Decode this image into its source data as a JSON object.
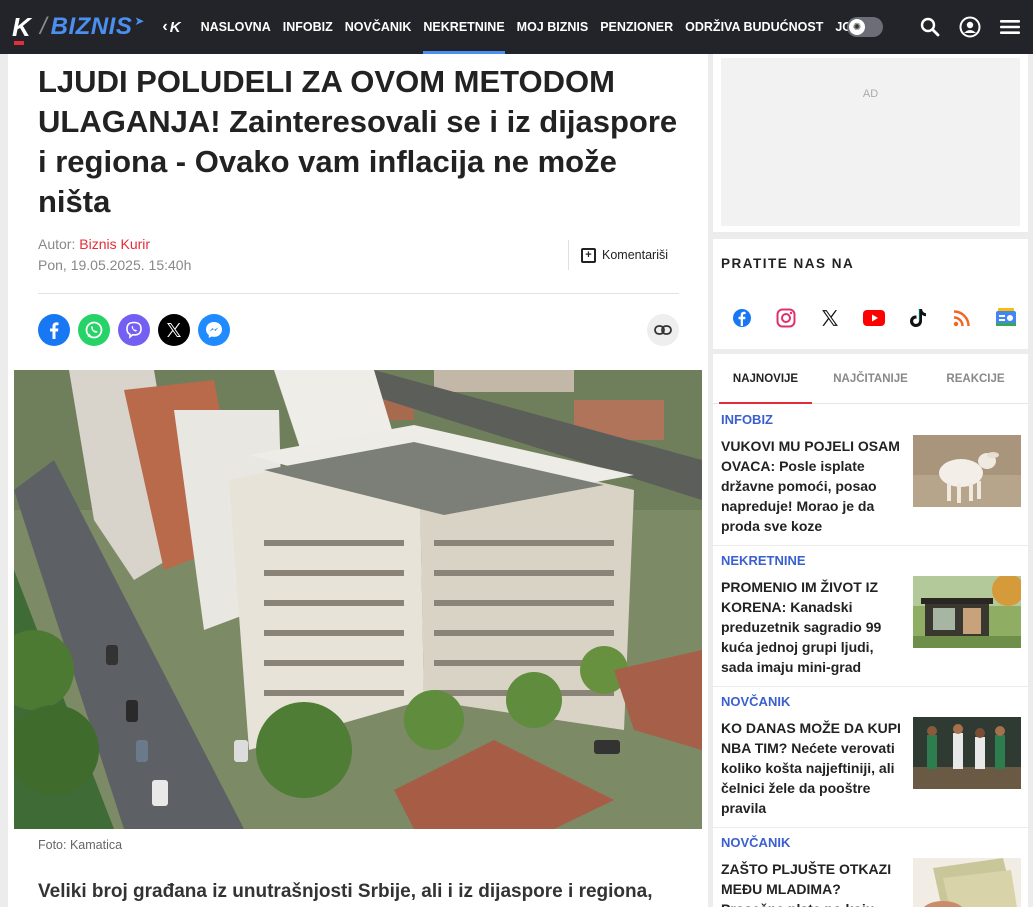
{
  "header": {
    "logo_k": "K",
    "logo_sep": "/",
    "logo_name": "BIZNIS",
    "back_label": "K",
    "nav": [
      {
        "label": "NASLOVNA",
        "active": false
      },
      {
        "label": "INFOBIZ",
        "active": false
      },
      {
        "label": "NOVČANIK",
        "active": false
      },
      {
        "label": "NEKRETNINE",
        "active": true
      },
      {
        "label": "MOJ BIZNIS",
        "active": false
      },
      {
        "label": "PENZIONER",
        "active": false
      },
      {
        "label": "ODRŽIVA BUDUĆNOST",
        "active": false
      },
      {
        "label": "JOŠ",
        "active": false
      }
    ],
    "icons": [
      "theme-toggle-icon",
      "search-icon",
      "user-icon",
      "menu-icon"
    ]
  },
  "article": {
    "headline": "LJUDI POLUDELI ZA OVOM METODOM ULAGANJA! Zainteresovali se i iz dijaspore i regiona - Ovako vam inflacija ne može ništa",
    "author_prefix": "Autor: ",
    "author_name": "Biznis Kurir",
    "date": "Pon, 19.05.2025. 15:40h",
    "comment_label": "Komentariši",
    "share": [
      {
        "name": "facebook-icon",
        "color": "#1877f2",
        "glyph": "f"
      },
      {
        "name": "whatsapp-icon",
        "color": "#25d366",
        "glyph": "✆"
      },
      {
        "name": "viber-icon",
        "color": "#7360f2",
        "glyph": "✆"
      },
      {
        "name": "x-icon",
        "color": "#000000",
        "glyph": "𝕏"
      },
      {
        "name": "messenger-icon",
        "color": "#1f8bff",
        "glyph": "⚡"
      }
    ],
    "caption": "Foto: Kamatica",
    "lead": "Veliki broj građana iz unutrašnjosti Srbije, ali i iz dijaspore i regiona,"
  },
  "sidebar": {
    "ad_label": "AD",
    "follow_title": "PRATITE NAS NA",
    "social": [
      {
        "name": "facebook-icon",
        "color": "#1877f2"
      },
      {
        "name": "instagram-icon",
        "color": "#e1306c"
      },
      {
        "name": "x-icon",
        "color": "#111111"
      },
      {
        "name": "youtube-icon",
        "color": "#ff0000"
      },
      {
        "name": "tiktok-icon",
        "color": "#111111"
      },
      {
        "name": "rss-icon",
        "color": "#f26522"
      },
      {
        "name": "google-news-icon",
        "color": "#4285f4"
      }
    ],
    "tabs": [
      {
        "label": "NAJNOVIJE",
        "active": true
      },
      {
        "label": "NAJČITANIJE",
        "active": false
      },
      {
        "label": "REAKCIJE",
        "active": false
      }
    ],
    "news": [
      {
        "category": "INFOBIZ",
        "title": "VUKOVI MU POJELI OSAM OVACA: Posle isplate državne pomoći, posao napreduje! Morao je da proda sve koze",
        "thumb": "lamb"
      },
      {
        "category": "NEKRETNINE",
        "title": "PROMENIO IM ŽIVOT IZ KORENA: Kanadski preduzetnik sagradio 99 kuća jednoj grupi ljudi, sada imaju mini-grad",
        "thumb": "house"
      },
      {
        "category": "NOVČANIK",
        "title": "KO DANAS MOŽE DA KUPI NBA TIM? Nećete verovati koliko košta najjeftiniji, ali čelnici žele da pooštre pravila",
        "thumb": "basketball"
      },
      {
        "category": "NOVČANIK",
        "title": "ZAŠTO PLJUŠTE OTKAZI MEĐU MLADIMA? Prosečne plate po koju",
        "thumb": "money"
      }
    ]
  }
}
